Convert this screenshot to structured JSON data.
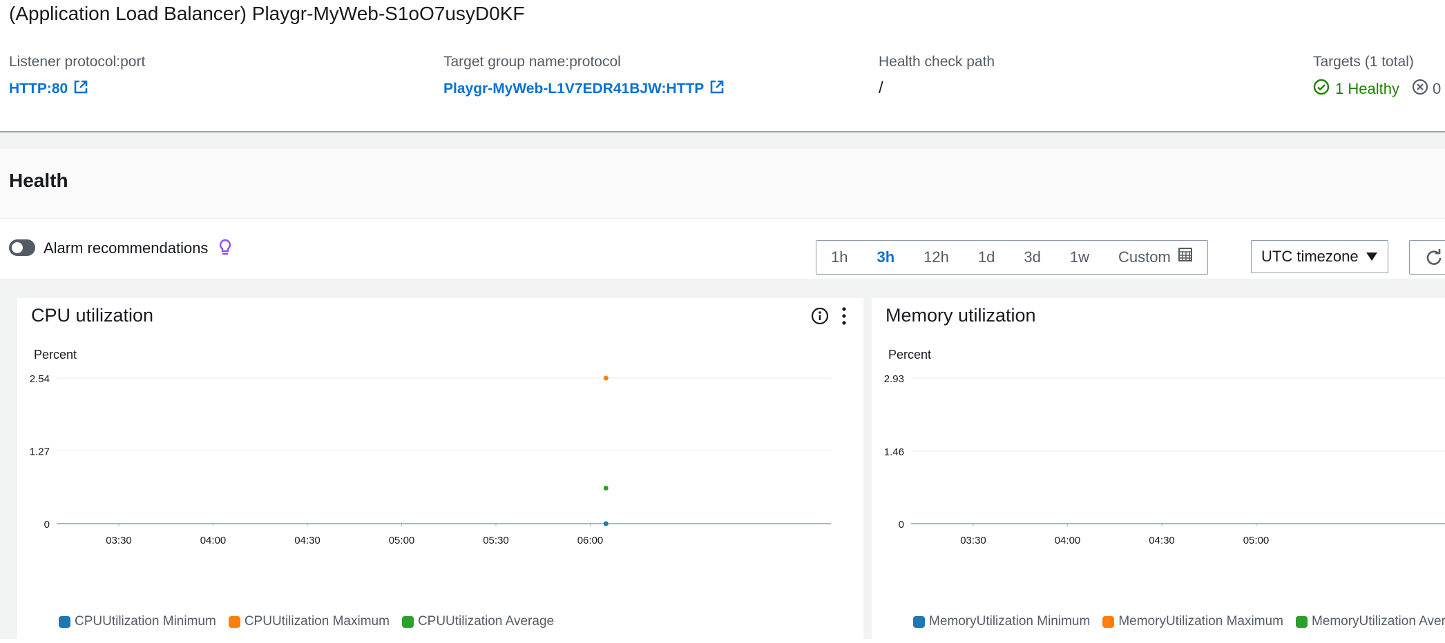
{
  "header": {
    "title": "(Application Load Balancer) Playgr-MyWeb-S1oO7usyD0KF"
  },
  "info": {
    "listener_label": "Listener protocol:port",
    "listener_value": "HTTP:80",
    "target_group_label": "Target group name:protocol",
    "target_group_value": "Playgr-MyWeb-L1V7EDR41BJW:HTTP",
    "health_path_label": "Health check path",
    "health_path_value": "/",
    "targets_label": "Targets (1 total)",
    "targets_healthy": "1 Healthy",
    "targets_unhealthy": "0"
  },
  "health": {
    "title": "Health",
    "alarm_label": "Alarm recommendations",
    "ranges": [
      "1h",
      "3h",
      "12h",
      "1d",
      "3d",
      "1w"
    ],
    "active_range": "3h",
    "custom_label": "Custom",
    "timezone": "UTC timezone"
  },
  "colors": {
    "minimum": "#1f77b4",
    "maximum": "#ff7f0e",
    "average": "#2ca02c",
    "link": "#0972d3",
    "healthy": "#1d8102"
  },
  "chart_data": [
    {
      "type": "scatter",
      "title": "CPU utilization",
      "ylabel": "Percent",
      "yticks": [
        "0",
        "1.27",
        "2.54"
      ],
      "ylim": [
        0,
        2.54
      ],
      "xticks": [
        "03:30",
        "04:00",
        "04:30",
        "05:00",
        "05:30",
        "06:00"
      ],
      "series": [
        {
          "name": "CPUUtilization Minimum",
          "points": [
            {
              "x": "06:05",
              "y": 0
            }
          ]
        },
        {
          "name": "CPUUtilization Maximum",
          "points": [
            {
              "x": "06:05",
              "y": 2.54
            }
          ]
        },
        {
          "name": "CPUUtilization Average",
          "points": [
            {
              "x": "06:05",
              "y": 0.62
            }
          ]
        }
      ]
    },
    {
      "type": "scatter",
      "title": "Memory utilization",
      "ylabel": "Percent",
      "yticks": [
        "0",
        "1.46",
        "2.93"
      ],
      "ylim": [
        0,
        2.93
      ],
      "xticks": [
        "03:30",
        "04:00",
        "04:30",
        "05:00"
      ],
      "series": [
        {
          "name": "MemoryUtilization Minimum",
          "points": []
        },
        {
          "name": "MemoryUtilization Maximum",
          "points": []
        },
        {
          "name": "MemoryUtilization Average",
          "points": []
        }
      ]
    }
  ]
}
